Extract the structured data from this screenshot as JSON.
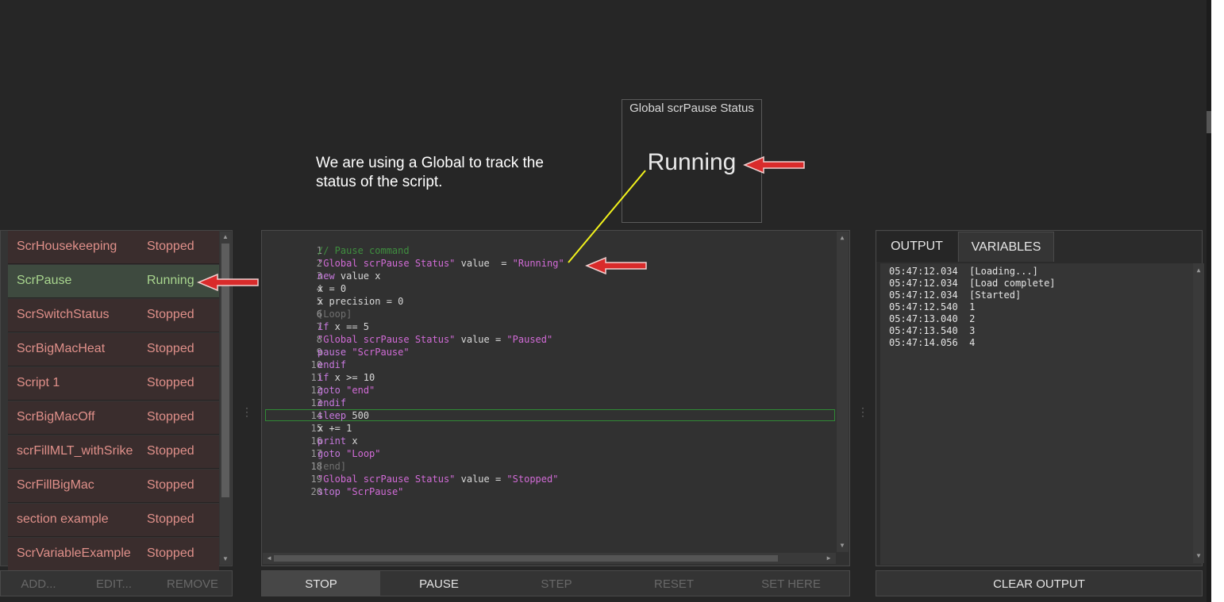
{
  "status_widget": {
    "title": "Global scrPause Status",
    "value": "Running"
  },
  "annotation": {
    "line1": "We are using a Global to track the",
    "line2": "status of the script."
  },
  "script_list": {
    "items": [
      {
        "name": "ScrHousekeeping",
        "status": "Stopped"
      },
      {
        "name": "ScrPause",
        "status": "Running"
      },
      {
        "name": "ScrSwitchStatus",
        "status": "Stopped"
      },
      {
        "name": "ScrBigMacHeat",
        "status": "Stopped"
      },
      {
        "name": "Script 1",
        "status": "Stopped"
      },
      {
        "name": "ScrBigMacOff",
        "status": "Stopped"
      },
      {
        "name": "scrFillMLT_withSrike",
        "status": "Stopped"
      },
      {
        "name": "ScrFillBigMac",
        "status": "Stopped"
      },
      {
        "name": "section example",
        "status": "Stopped"
      },
      {
        "name": "ScrVariableExample",
        "status": "Stopped"
      }
    ]
  },
  "list_buttons": {
    "add": "ADD...",
    "edit": "EDIT...",
    "remove": "REMOVE"
  },
  "editor": {
    "lines": [
      {
        "n": "1",
        "parts": [
          [
            "// Pause command",
            "cm"
          ]
        ]
      },
      {
        "n": "2",
        "parts": [
          [
            "\"Global scrPause Status\"",
            "str"
          ],
          [
            " value  = ",
            "plain"
          ],
          [
            "\"Running\"",
            "str"
          ]
        ]
      },
      {
        "n": "3",
        "parts": [
          [
            "new",
            "kw"
          ],
          [
            " value x",
            "plain"
          ]
        ]
      },
      {
        "n": "4",
        "parts": [
          [
            "x = 0",
            "plain"
          ]
        ]
      },
      {
        "n": "5",
        "parts": [
          [
            "x precision = 0",
            "plain"
          ]
        ]
      },
      {
        "n": "6",
        "parts": [
          [
            "[Loop]",
            "dim"
          ]
        ]
      },
      {
        "n": "7",
        "parts": [
          [
            "if",
            "kw"
          ],
          [
            " x == 5",
            "plain"
          ]
        ]
      },
      {
        "n": "8",
        "parts": [
          [
            "\"Global scrPause Status\"",
            "str"
          ],
          [
            " value = ",
            "plain"
          ],
          [
            "\"Paused\"",
            "str"
          ]
        ]
      },
      {
        "n": "9",
        "parts": [
          [
            "pause",
            "kw"
          ],
          [
            " ",
            "plain"
          ],
          [
            "\"ScrPause\"",
            "str"
          ]
        ]
      },
      {
        "n": "10",
        "parts": [
          [
            "endif",
            "kw"
          ]
        ]
      },
      {
        "n": "11",
        "parts": [
          [
            "if",
            "kw"
          ],
          [
            " x >= 10",
            "plain"
          ]
        ]
      },
      {
        "n": "12",
        "parts": [
          [
            "goto",
            "kw"
          ],
          [
            " ",
            "plain"
          ],
          [
            "\"end\"",
            "str"
          ]
        ]
      },
      {
        "n": "13",
        "parts": [
          [
            "endif",
            "kw"
          ]
        ]
      },
      {
        "n": "14",
        "parts": [
          [
            "sleep",
            "kw"
          ],
          [
            " 500",
            "plain"
          ]
        ]
      },
      {
        "n": "15",
        "parts": [
          [
            "x += 1",
            "plain"
          ]
        ]
      },
      {
        "n": "16",
        "parts": [
          [
            "print",
            "kw"
          ],
          [
            " x",
            "plain"
          ]
        ]
      },
      {
        "n": "17",
        "parts": [
          [
            "goto",
            "kw"
          ],
          [
            " ",
            "plain"
          ],
          [
            "\"Loop\"",
            "str"
          ]
        ]
      },
      {
        "n": "18",
        "parts": [
          [
            "[end]",
            "dim"
          ]
        ]
      },
      {
        "n": "19",
        "parts": [
          [
            "\"Global scrPause Status\"",
            "str"
          ],
          [
            " value = ",
            "plain"
          ],
          [
            "\"Stopped\"",
            "str"
          ]
        ]
      },
      {
        "n": "20",
        "parts": [
          [
            "stop",
            "kw"
          ],
          [
            " ",
            "plain"
          ],
          [
            "\"ScrPause\"",
            "str"
          ]
        ]
      }
    ],
    "current_line": "14"
  },
  "editor_buttons": {
    "stop": "STOP",
    "pause": "PAUSE",
    "step": "STEP",
    "reset": "RESET",
    "set_here": "SET HERE"
  },
  "output_panel": {
    "tabs": [
      "OUTPUT",
      "VARIABLES"
    ],
    "active_tab": "OUTPUT",
    "log": [
      {
        "time": "05:47:12.034",
        "msg": "[Loading...]"
      },
      {
        "time": "05:47:12.034",
        "msg": "[Load complete]"
      },
      {
        "time": "05:47:12.034",
        "msg": "[Started]"
      },
      {
        "time": "05:47:12.540",
        "msg": "1"
      },
      {
        "time": "05:47:13.040",
        "msg": "2"
      },
      {
        "time": "05:47:13.540",
        "msg": "3"
      },
      {
        "time": "05:47:14.056",
        "msg": "4"
      }
    ],
    "clear_button": "CLEAR OUTPUT"
  },
  "colors": {
    "background": "#262626",
    "stopped_text": "#e0908a",
    "running_text": "#a8d58e",
    "running_row_bg": "#3e4a3f",
    "stopped_row_bg": "#3a2d2d",
    "keyword": "#c678dd",
    "comment": "#3f8f3f",
    "current_line_border": "#2f8a35",
    "annotation_arrow": "#d92b2b",
    "annotation_line": "#f2f21c"
  }
}
